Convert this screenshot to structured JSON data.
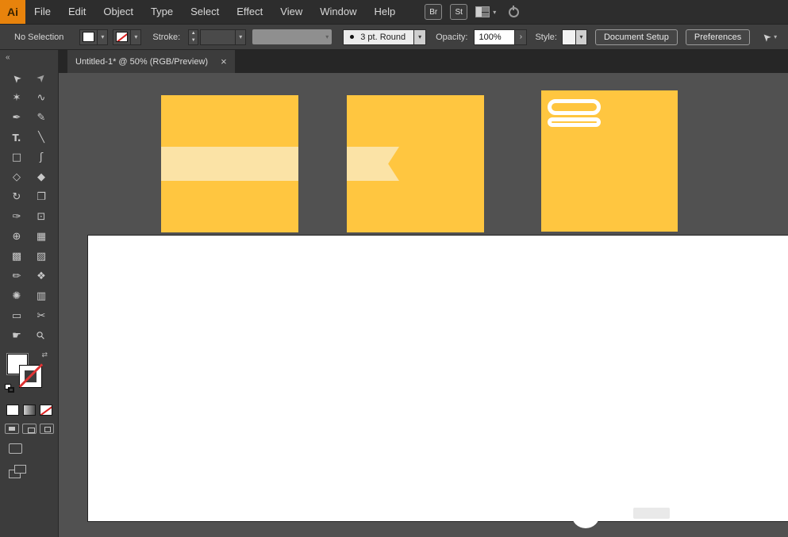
{
  "menubar": {
    "logo_text": "Ai",
    "items": [
      "File",
      "Edit",
      "Object",
      "Type",
      "Select",
      "Effect",
      "View",
      "Window",
      "Help"
    ],
    "bridge_button": "Br",
    "stock_button": "St"
  },
  "controlbar": {
    "selection_status": "No Selection",
    "stroke_label": "Stroke:",
    "brush_name": "3 pt. Round",
    "opacity_label": "Opacity:",
    "opacity_value": "100%",
    "style_label": "Style:",
    "document_setup": "Document Setup",
    "preferences": "Preferences"
  },
  "tabbar": {
    "collapse_glyph": "«",
    "title": "Untitled-1* @ 50% (RGB/Preview)",
    "close_glyph": "×"
  },
  "glyphs": {
    "chevron_down": "▾",
    "stepper_up": "▲",
    "stepper_down": "▼",
    "arrow_right": "›",
    "swap": "⇄",
    "cursor": "➤"
  },
  "toolbar": {
    "tools": [
      {
        "name": "selection",
        "glyph": "➤"
      },
      {
        "name": "direct-selection",
        "glyph": "➤"
      },
      {
        "name": "magic-wand",
        "glyph": "✶"
      },
      {
        "name": "lasso",
        "glyph": "∿"
      },
      {
        "name": "pen",
        "glyph": "✒"
      },
      {
        "name": "pencil",
        "glyph": "✎"
      },
      {
        "name": "type",
        "glyph": "T."
      },
      {
        "name": "line-segment",
        "glyph": "╲"
      },
      {
        "name": "rectangle",
        "glyph": "□"
      },
      {
        "name": "paintbrush",
        "glyph": "ʃ"
      },
      {
        "name": "shaper",
        "glyph": "◇"
      },
      {
        "name": "eraser",
        "glyph": "◆"
      },
      {
        "name": "rotate",
        "glyph": "↻"
      },
      {
        "name": "scale",
        "glyph": "❐"
      },
      {
        "name": "width",
        "glyph": "✑"
      },
      {
        "name": "free-transform",
        "glyph": "⊡"
      },
      {
        "name": "shape-builder",
        "glyph": "⊕"
      },
      {
        "name": "perspective-grid",
        "glyph": "▦"
      },
      {
        "name": "mesh",
        "glyph": "▩"
      },
      {
        "name": "gradient",
        "glyph": "▨"
      },
      {
        "name": "eyedropper",
        "glyph": "✏"
      },
      {
        "name": "blend",
        "glyph": "❖"
      },
      {
        "name": "symbol-sprayer",
        "glyph": "✺"
      },
      {
        "name": "column-graph",
        "glyph": "▥"
      },
      {
        "name": "artboard",
        "glyph": "▭"
      },
      {
        "name": "slice",
        "glyph": "✂"
      },
      {
        "name": "hand",
        "glyph": "☛"
      },
      {
        "name": "zoom",
        "glyph": "⚲"
      }
    ]
  },
  "canvas": {
    "background_color": "#515151",
    "artboard_color": "#ffffff",
    "card_fill_color": "#ffc640",
    "card_accent_color": "#fbe3a6"
  }
}
